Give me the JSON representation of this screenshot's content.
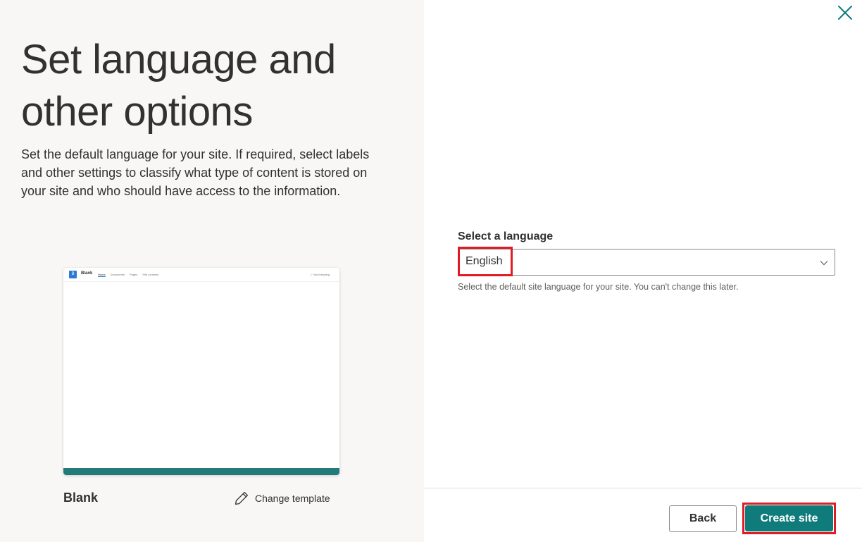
{
  "left": {
    "title": "Set language and other options",
    "description": "Set the default language for your site. If required, select labels and other settings to classify what type of content is stored on your site and who should have access to the information.",
    "preview": {
      "logo_letter": "B",
      "site_name": "Blank",
      "nav": [
        "Home",
        "Documents",
        "Pages",
        "Site contents"
      ],
      "follow": "☆ Not following"
    },
    "template_name": "Blank",
    "change_template_label": "Change template"
  },
  "right": {
    "language_label": "Select a language",
    "language_value": "English",
    "language_help": "Select the default site language for your site. You can't change this later."
  },
  "footer": {
    "back_label": "Back",
    "create_label": "Create site"
  },
  "icons": {
    "close": "close-icon",
    "chevron": "chevron-down-icon",
    "pencil": "pencil-icon"
  },
  "colors": {
    "accent": "#0f7b7b",
    "highlight": "#e01b24",
    "left_bg": "#f8f7f6"
  }
}
